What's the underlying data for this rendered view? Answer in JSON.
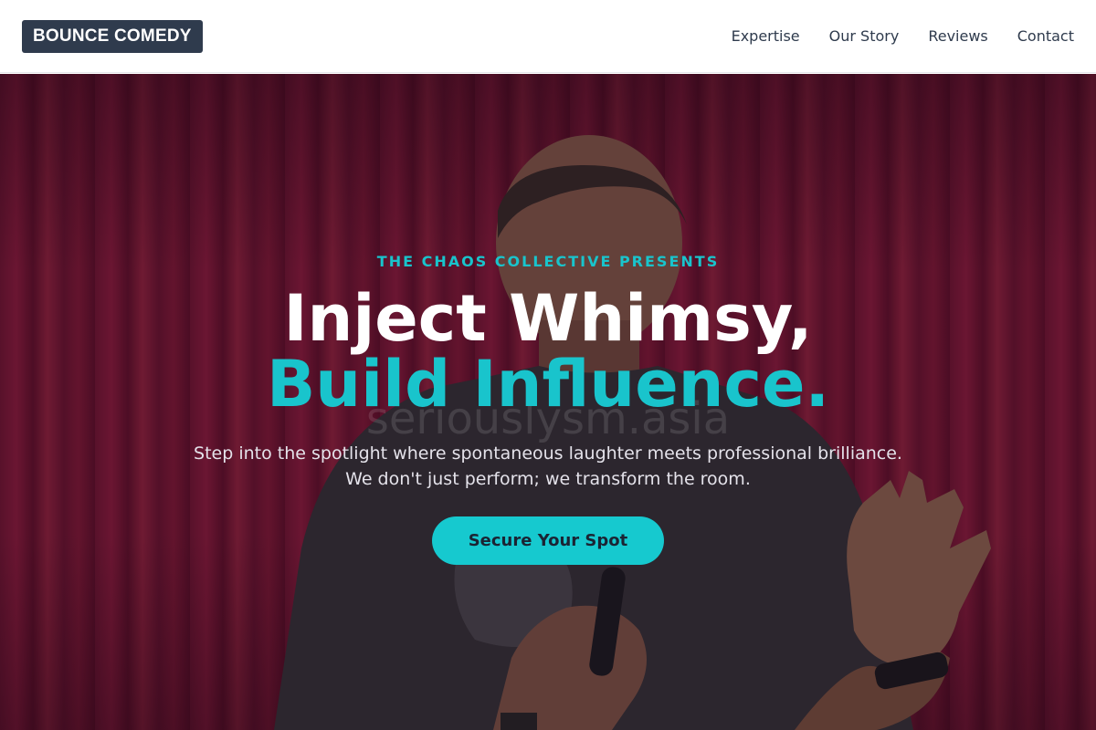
{
  "header": {
    "brand": "BOUNCE COMEDY",
    "nav": [
      {
        "label": "Expertise"
      },
      {
        "label": "Our Story"
      },
      {
        "label": "Reviews"
      },
      {
        "label": "Contact"
      }
    ]
  },
  "hero": {
    "eyebrow": "THE CHAOS COLLECTIVE PRESENTS",
    "headline_line1": "Inject Whimsy,",
    "headline_line2": "Build Influence.",
    "subtitle_line1": "Step into the spotlight where spontaneous laughter meets professional brilliance.",
    "subtitle_line2": "We don't just perform; we transform the room.",
    "cta": "Secure Your Spot",
    "watermark": "seriouslysm.asia"
  },
  "colors": {
    "accent": "#19c4cc",
    "brand_bg": "#2f3b4d",
    "curtain": "#8e1937"
  }
}
